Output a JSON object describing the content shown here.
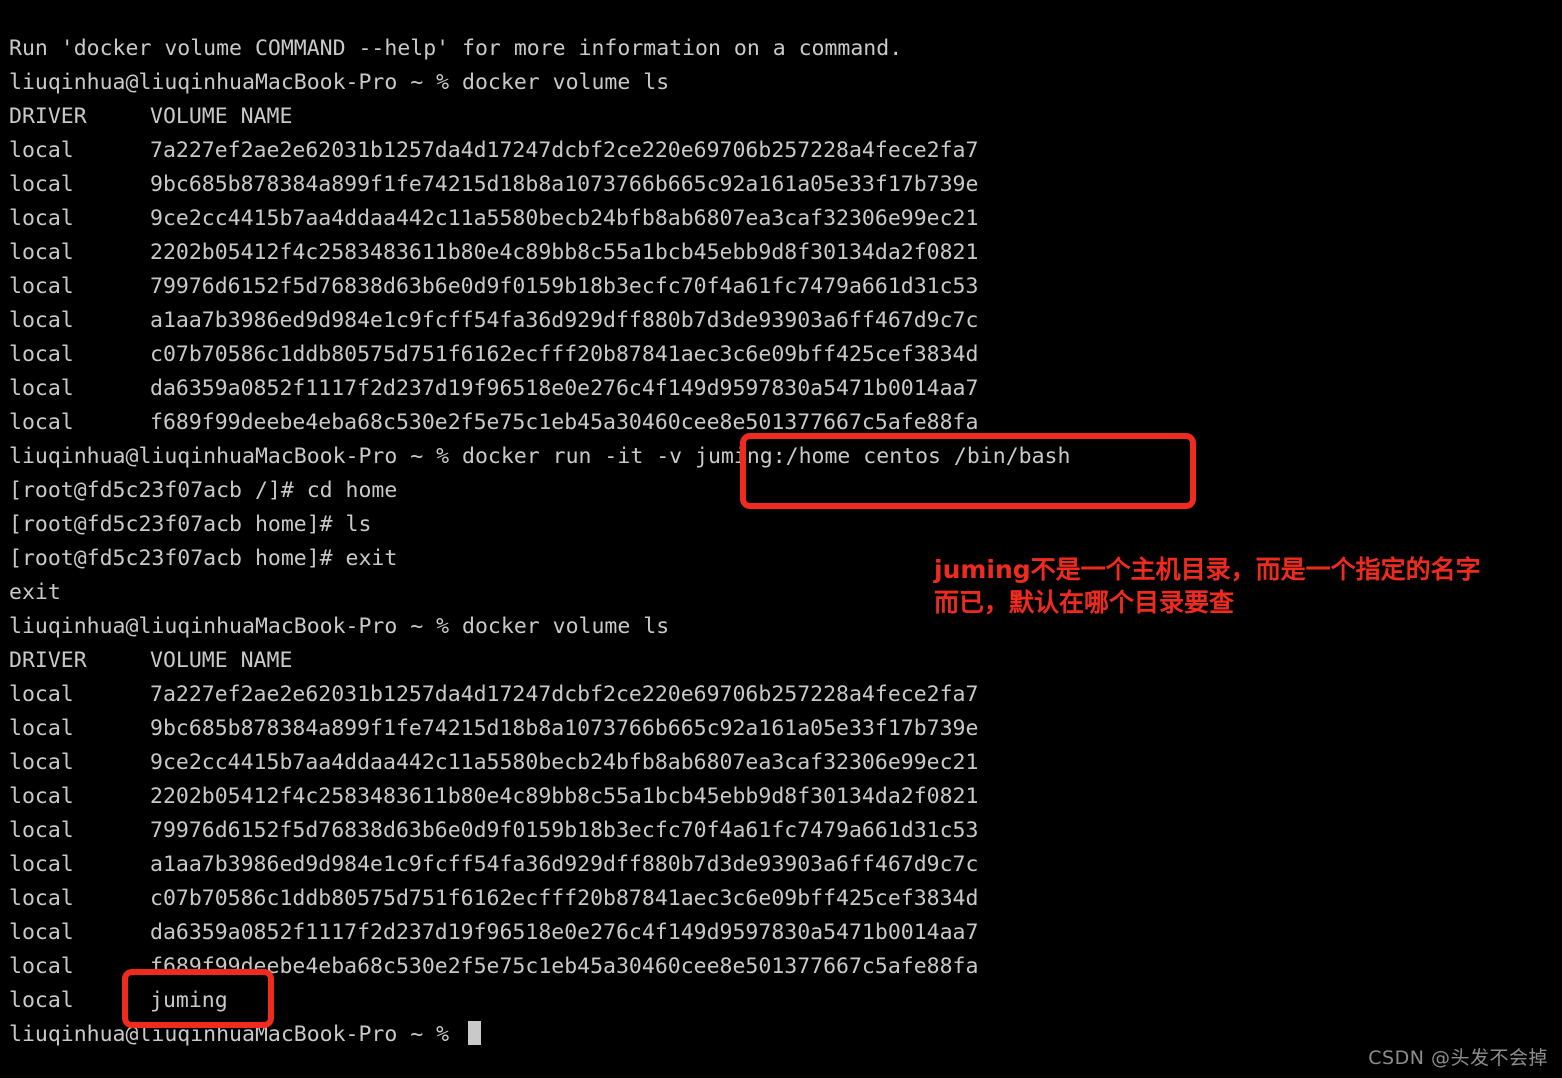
{
  "terminal": {
    "prompt": "liuqinhua@liuqinhuaMacBook-Pro ~ % ",
    "container_prompt_root": "[root@fd5c23f07acb /]# ",
    "container_prompt_home": "[root@fd5c23f07acb home]# ",
    "header_driver": "DRIVER",
    "header_volume": "VOLUME NAME",
    "driver_value": "local",
    "lines": [
      "Run 'docker volume COMMAND --help' for more information on a command.",
      "liuqinhua@liuqinhuaMacBook-Pro ~ % docker volume ls"
    ],
    "commands": {
      "volume_ls": "docker volume ls",
      "docker_run": "docker run -it -v juming:/home centos /bin/bash",
      "cd_home": "cd home",
      "ls": "ls",
      "exit": "exit",
      "exit_output": "exit"
    },
    "volumes_before": [
      "7a227ef2ae2e62031b1257da4d17247dcbf2ce220e69706b257228a4fece2fa7",
      "9bc685b878384a899f1fe74215d18b8a1073766b665c92a161a05e33f17b739e",
      "9ce2cc4415b7aa4ddaa442c11a5580becb24bfb8ab6807ea3caf32306e99ec21",
      "2202b05412f4c2583483611b80e4c89bb8c55a1bcb45ebb9d8f30134da2f0821",
      "79976d6152f5d76838d63b6e0d9f0159b18b3ecfc70f4a61fc7479a661d31c53",
      "a1aa7b3986ed9d984e1c9fcff54fa36d929dff880b7d3de93903a6ff467d9c7c",
      "c07b70586c1ddb80575d751f6162ecfff20b87841aec3c6e09bff425cef3834d",
      "da6359a0852f1117f2d237d19f96518e0e276c4f149d9597830a5471b0014aa7",
      "f689f99deebe4eba68c530e2f5e75c1eb45a30460cee8e501377667c5afe88fa"
    ],
    "volumes_after": [
      "7a227ef2ae2e62031b1257da4d17247dcbf2ce220e69706b257228a4fece2fa7",
      "9bc685b878384a899f1fe74215d18b8a1073766b665c92a161a05e33f17b739e",
      "9ce2cc4415b7aa4ddaa442c11a5580becb24bfb8ab6807ea3caf32306e99ec21",
      "2202b05412f4c2583483611b80e4c89bb8c55a1bcb45ebb9d8f30134da2f0821",
      "79976d6152f5d76838d63b6e0d9f0159b18b3ecfc70f4a61fc7479a661d31c53",
      "a1aa7b3986ed9d984e1c9fcff54fa36d929dff880b7d3de93903a6ff467d9c7c",
      "c07b70586c1ddb80575d751f6162ecfff20b87841aec3c6e09bff425cef3834d",
      "da6359a0852f1117f2d237d19f96518e0e276c4f149d9597830a5471b0014aa7",
      "f689f99deebe4eba68c530e2f5e75c1eb45a30460cee8e501377667c5afe88fa",
      "juming"
    ],
    "full_lines": {
      "l01": "Run 'docker volume COMMAND --help' for more information on a command.",
      "l02": "liuqinhua@liuqinhuaMacBook-Pro ~ % docker volume ls",
      "l12": "liuqinhua@liuqinhuaMacBook-Pro ~ % docker run -it -v juming:/home centos /bin/bash",
      "l13": "[root@fd5c23f07acb /]# cd home",
      "l14": "[root@fd5c23f07acb home]# ls",
      "l15": "[root@fd5c23f07acb home]# exit",
      "l16": "exit",
      "l17": "liuqinhua@liuqinhuaMacBook-Pro ~ % docker volume ls",
      "l29": "liuqinhua@liuqinhuaMacBook-Pro ~ % "
    }
  },
  "annotation": {
    "text": "juming不是一个主机目录，而是一个指定的名字\n而已，默认在哪个目录要查",
    "color": "#ef2b20"
  },
  "highlights": {
    "command_box_label": "juming:/home centos /bin/bash",
    "volume_box_label": "juming",
    "color": "#ef2b20"
  },
  "watermark": {
    "text": "CSDN @头发不会掉"
  },
  "colors": {
    "background": "#000000",
    "foreground": "#c9c9c9",
    "accent_red": "#ef2b20",
    "watermark": "#8d8d8d"
  }
}
